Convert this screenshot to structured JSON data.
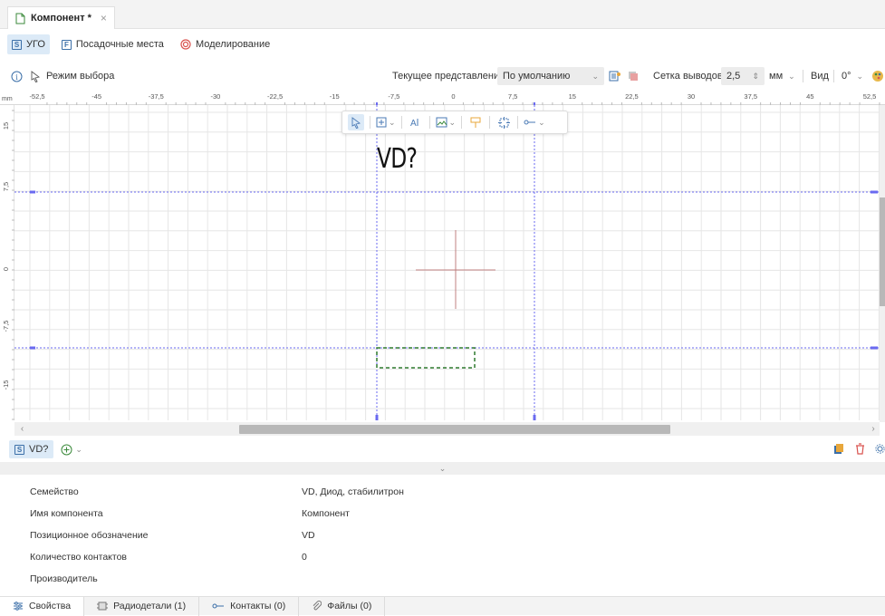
{
  "doc_tab": {
    "title": "Компонент *",
    "close_glyph": "×"
  },
  "mode_tabs": [
    {
      "label": "УГО",
      "icon": "schematic-symbol-icon",
      "active": true
    },
    {
      "label": "Посадочные места",
      "icon": "footprint-icon",
      "active": false
    },
    {
      "label": "Моделирование",
      "icon": "modeling-icon",
      "active": false
    }
  ],
  "toolbar": {
    "mode_label": "Режим выбора",
    "view_label": "Текущее представление",
    "view_value": "По умолчанию",
    "pin_grid_label": "Сетка выводов",
    "pin_grid_value": "2,5",
    "unit_value": "мм",
    "view_short": "Вид",
    "rotation_value": "0°"
  },
  "ruler": {
    "unit": "mm",
    "x_ticks": [
      "-52,5",
      "-45",
      "-37,5",
      "-30",
      "-22,5",
      "-15",
      "-7,5",
      "0",
      "7,5",
      "15",
      "22,5",
      "30",
      "37,5",
      "45",
      "52,5"
    ],
    "y_ticks": [
      "15",
      "7,5",
      "0",
      "-7,5",
      "-15"
    ]
  },
  "canvas": {
    "designator_text": "VD?",
    "colors": {
      "guide": "#6a6af0",
      "selection": "#2f7a2f",
      "crosshair": "#c08080",
      "grid": "#e6e6e6",
      "grid_major": "#d8d8d8"
    }
  },
  "component_bar": {
    "chip_label": "VD?"
  },
  "properties": [
    {
      "key": "Семейство",
      "value": "VD, Диод, стабилитрон"
    },
    {
      "key": "Имя компонента",
      "value": "Компонент"
    },
    {
      "key": "Позиционное обозначение",
      "value": "VD"
    },
    {
      "key": "Количество контактов",
      "value": "0"
    },
    {
      "key": "Производитель",
      "value": ""
    }
  ],
  "bottom_tabs": [
    {
      "label": "Свойства",
      "icon": "properties-icon",
      "active": true
    },
    {
      "label": "Радиодетали (1)",
      "icon": "chip-icon",
      "active": false
    },
    {
      "label": "Контакты (0)",
      "icon": "pin-icon",
      "active": false
    },
    {
      "label": "Файлы (0)",
      "icon": "paperclip-icon",
      "active": false
    }
  ]
}
